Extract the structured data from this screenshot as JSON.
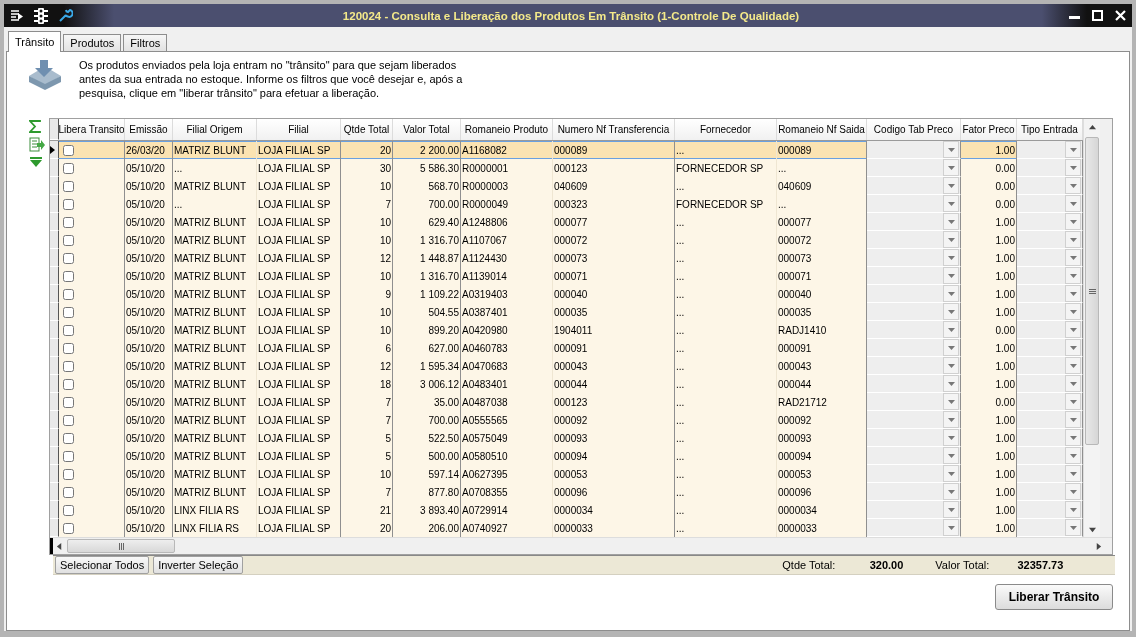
{
  "window": {
    "title": "120024 - Consulta e Liberação dos Produtos Em Trânsito (1-Controle De Qualidade)"
  },
  "tabs": [
    {
      "label": "Trânsito",
      "selected": true
    },
    {
      "label": "Produtos",
      "selected": false
    },
    {
      "label": "Filtros",
      "selected": false
    }
  ],
  "info": {
    "text": "Os produtos enviados pela loja entram no \"trânsito\" para que sejam liberados antes da sua entrada no estoque. Informe os filtros que você desejar e, após a pesquisa, clique em \"liberar trânsito\" para efetuar a liberação."
  },
  "table": {
    "columns": [
      {
        "label": "Libera Transito",
        "kind": "check"
      },
      {
        "label": "Emissão",
        "kind": "text"
      },
      {
        "label": "Filial Origem",
        "kind": "text"
      },
      {
        "label": "Filial",
        "kind": "text"
      },
      {
        "label": "Qtde Total",
        "kind": "num"
      },
      {
        "label": "Valor Total",
        "kind": "num"
      },
      {
        "label": "Romaneio Produto",
        "kind": "text"
      },
      {
        "label": "Numero Nf Transferencia",
        "kind": "text"
      },
      {
        "label": "Fornecedor",
        "kind": "text"
      },
      {
        "label": "Romaneio Nf Saida",
        "kind": "text"
      },
      {
        "label": "Codigo Tab Preco",
        "kind": "combo"
      },
      {
        "label": "Fator Preco",
        "kind": "num"
      },
      {
        "label": "Tipo Entrada",
        "kind": "combo"
      }
    ],
    "rows": [
      {
        "selected": true,
        "checked": false,
        "cells": [
          "",
          "26/03/20",
          "MATRIZ BLUNT",
          "LOJA FILIAL SP",
          "20",
          "2 200.00",
          "A1168082",
          "000089",
          "...",
          "000089",
          "",
          "1.00",
          ""
        ]
      },
      {
        "selected": false,
        "checked": false,
        "cells": [
          "",
          "05/10/20",
          "...",
          "LOJA FILIAL SP",
          "30",
          "5 586.30",
          "R0000001",
          "000123",
          "FORNECEDOR SP",
          "...",
          "",
          "0.00",
          ""
        ]
      },
      {
        "selected": false,
        "checked": false,
        "cells": [
          "",
          "05/10/20",
          "MATRIZ BLUNT",
          "LOJA FILIAL SP",
          "10",
          "568.70",
          "R0000003",
          "040609",
          "...",
          "040609",
          "",
          "0.00",
          ""
        ]
      },
      {
        "selected": false,
        "checked": false,
        "cells": [
          "",
          "05/10/20",
          "...",
          "LOJA FILIAL SP",
          "7",
          "700.00",
          "R0000049",
          "000323",
          "FORNECEDOR SP",
          "...",
          "",
          "0.00",
          ""
        ]
      },
      {
        "selected": false,
        "checked": false,
        "cells": [
          "",
          "05/10/20",
          "MATRIZ BLUNT",
          "LOJA FILIAL SP",
          "10",
          "629.40",
          "A1248806",
          "000077",
          "...",
          "000077",
          "",
          "1.00",
          ""
        ]
      },
      {
        "selected": false,
        "checked": false,
        "cells": [
          "",
          "05/10/20",
          "MATRIZ BLUNT",
          "LOJA FILIAL SP",
          "10",
          "1 316.70",
          "A1107067",
          "000072",
          "...",
          "000072",
          "",
          "1.00",
          ""
        ]
      },
      {
        "selected": false,
        "checked": false,
        "cells": [
          "",
          "05/10/20",
          "MATRIZ BLUNT",
          "LOJA FILIAL SP",
          "12",
          "1 448.87",
          "A1124430",
          "000073",
          "...",
          "000073",
          "",
          "1.00",
          ""
        ]
      },
      {
        "selected": false,
        "checked": false,
        "cells": [
          "",
          "05/10/20",
          "MATRIZ BLUNT",
          "LOJA FILIAL SP",
          "10",
          "1 316.70",
          "A1139014",
          "000071",
          "...",
          "000071",
          "",
          "1.00",
          ""
        ]
      },
      {
        "selected": false,
        "checked": false,
        "cells": [
          "",
          "05/10/20",
          "MATRIZ BLUNT",
          "LOJA FILIAL SP",
          "9",
          "1 109.22",
          "A0319403",
          "000040",
          "...",
          "000040",
          "",
          "1.00",
          ""
        ]
      },
      {
        "selected": false,
        "checked": false,
        "cells": [
          "",
          "05/10/20",
          "MATRIZ BLUNT",
          "LOJA FILIAL SP",
          "10",
          "504.55",
          "A0387401",
          "000035",
          "...",
          "000035",
          "",
          "1.00",
          ""
        ]
      },
      {
        "selected": false,
        "checked": false,
        "cells": [
          "",
          "05/10/20",
          "MATRIZ BLUNT",
          "LOJA FILIAL SP",
          "10",
          "899.20",
          "A0420980",
          "1904011",
          "...",
          "RADJ1410",
          "",
          "0.00",
          ""
        ]
      },
      {
        "selected": false,
        "checked": false,
        "cells": [
          "",
          "05/10/20",
          "MATRIZ BLUNT",
          "LOJA FILIAL SP",
          "6",
          "627.00",
          "A0460783",
          "000091",
          "...",
          "000091",
          "",
          "1.00",
          ""
        ]
      },
      {
        "selected": false,
        "checked": false,
        "cells": [
          "",
          "05/10/20",
          "MATRIZ BLUNT",
          "LOJA FILIAL SP",
          "12",
          "1 595.34",
          "A0470683",
          "000043",
          "...",
          "000043",
          "",
          "1.00",
          ""
        ]
      },
      {
        "selected": false,
        "checked": false,
        "cells": [
          "",
          "05/10/20",
          "MATRIZ BLUNT",
          "LOJA FILIAL SP",
          "18",
          "3 006.12",
          "A0483401",
          "000044",
          "...",
          "000044",
          "",
          "1.00",
          ""
        ]
      },
      {
        "selected": false,
        "checked": false,
        "cells": [
          "",
          "05/10/20",
          "MATRIZ BLUNT",
          "LOJA FILIAL SP",
          "7",
          "35.00",
          "A0487038",
          "000123",
          "...",
          "RAD21712",
          "",
          "0.00",
          ""
        ]
      },
      {
        "selected": false,
        "checked": false,
        "cells": [
          "",
          "05/10/20",
          "MATRIZ BLUNT",
          "LOJA FILIAL SP",
          "7",
          "700.00",
          "A0555565",
          "000092",
          "...",
          "000092",
          "",
          "1.00",
          ""
        ]
      },
      {
        "selected": false,
        "checked": false,
        "cells": [
          "",
          "05/10/20",
          "MATRIZ BLUNT",
          "LOJA FILIAL SP",
          "5",
          "522.50",
          "A0575049",
          "000093",
          "...",
          "000093",
          "",
          "1.00",
          ""
        ]
      },
      {
        "selected": false,
        "checked": false,
        "cells": [
          "",
          "05/10/20",
          "MATRIZ BLUNT",
          "LOJA FILIAL SP",
          "5",
          "500.00",
          "A0580510",
          "000094",
          "...",
          "000094",
          "",
          "1.00",
          ""
        ]
      },
      {
        "selected": false,
        "checked": false,
        "cells": [
          "",
          "05/10/20",
          "MATRIZ BLUNT",
          "LOJA FILIAL SP",
          "10",
          "597.14",
          "A0627395",
          "000053",
          "...",
          "000053",
          "",
          "1.00",
          ""
        ]
      },
      {
        "selected": false,
        "checked": false,
        "cells": [
          "",
          "05/10/20",
          "MATRIZ BLUNT",
          "LOJA FILIAL SP",
          "7",
          "877.80",
          "A0708355",
          "000096",
          "...",
          "000096",
          "",
          "1.00",
          ""
        ]
      },
      {
        "selected": false,
        "checked": false,
        "cells": [
          "",
          "05/10/20",
          "LINX FILIA RS",
          "LOJA FILIAL SP",
          "21",
          "3 893.40",
          "A0729914",
          "0000034",
          "...",
          "0000034",
          "",
          "1.00",
          ""
        ]
      },
      {
        "selected": false,
        "checked": false,
        "cells": [
          "",
          "05/10/20",
          "LINX FILIA RS",
          "LOJA FILIAL SP",
          "20",
          "206.00",
          "A0740927",
          "0000033",
          "...",
          "0000033",
          "",
          "1.00",
          ""
        ]
      }
    ]
  },
  "footer": {
    "buttons": [
      "Selecionar Todos",
      "Inverter Seleção"
    ],
    "totals": [
      {
        "label": "Qtde Total:",
        "value": "320.00"
      },
      {
        "label": "Valor Total:",
        "value": "32357.73"
      }
    ]
  },
  "action_button": "Liberar Trânsito"
}
